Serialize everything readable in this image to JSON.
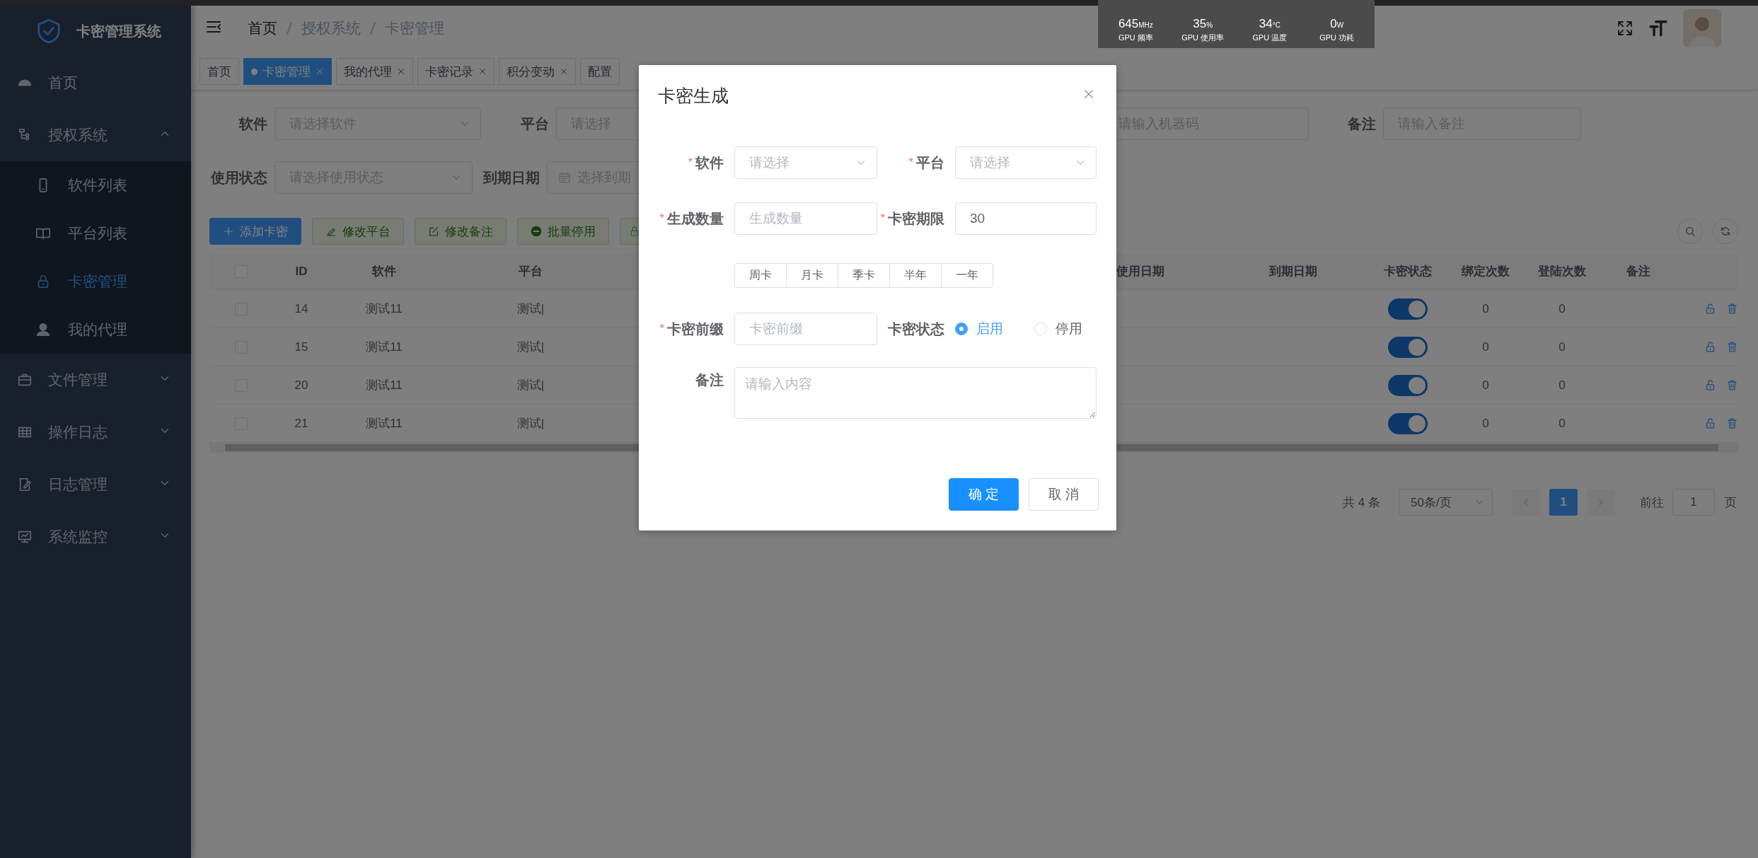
{
  "app": {
    "title": "卡密管理系统"
  },
  "sidebar": {
    "items": [
      {
        "label": "首页",
        "selected": false
      },
      {
        "label": "授权系统",
        "selected": false,
        "expanded": true,
        "children": [
          {
            "label": "软件列表",
            "selected": false
          },
          {
            "label": "平台列表",
            "selected": false
          },
          {
            "label": "卡密管理",
            "selected": true
          },
          {
            "label": "我的代理",
            "selected": false
          }
        ]
      },
      {
        "label": "文件管理",
        "selected": false,
        "expanded": false
      },
      {
        "label": "操作日志",
        "selected": false,
        "expanded": false
      },
      {
        "label": "日志管理",
        "selected": false,
        "expanded": false
      },
      {
        "label": "系统监控",
        "selected": false,
        "expanded": false
      }
    ]
  },
  "header": {
    "breadcrumb": [
      "首页",
      "授权系统",
      "卡密管理"
    ]
  },
  "perf_overlay": {
    "metrics": [
      {
        "value": "645",
        "unit": "MHz",
        "label": "GPU 频率"
      },
      {
        "value": "35",
        "unit": "%",
        "label": "GPU 使用率"
      },
      {
        "value": "34",
        "unit": "°C",
        "label": "GPU 温度"
      },
      {
        "value": "0",
        "unit": "W",
        "label": "GPU 功耗"
      }
    ]
  },
  "tabs": [
    {
      "label": "首页",
      "selected": false,
      "closable": false
    },
    {
      "label": "卡密管理",
      "selected": true,
      "closable": true
    },
    {
      "label": "我的代理",
      "selected": false,
      "closable": true
    },
    {
      "label": "卡密记录",
      "selected": false,
      "closable": true
    },
    {
      "label": "积分变动",
      "selected": false,
      "closable": true
    },
    {
      "label": "配置",
      "selected": false,
      "closable": false
    }
  ],
  "filters": {
    "row_1": [
      {
        "kind": "select",
        "label": "软件",
        "placeholder": "请选择软件"
      },
      {
        "kind": "input",
        "label": "平台",
        "placeholder": "请选择"
      },
      {
        "kind": "input",
        "placeholder": "请输入机器码"
      },
      {
        "kind": "input",
        "label": "备注",
        "placeholder": "请输入备注"
      }
    ],
    "row_2": [
      {
        "kind": "select",
        "label": "使用状态",
        "placeholder": "请选择使用状态"
      },
      {
        "kind": "date",
        "label": "到期日期",
        "placeholder": "选择到期"
      }
    ]
  },
  "toolbar": {
    "buttons": [
      {
        "kind": "primary",
        "label": "添加卡密",
        "disabled": false
      },
      {
        "kind": "plain",
        "label": "修改平台",
        "disabled": true
      },
      {
        "kind": "plain",
        "label": "修改备注",
        "disabled": true
      },
      {
        "kind": "plain",
        "label": "批量停用",
        "disabled": true
      },
      {
        "kind": "plain"
      }
    ]
  },
  "table": {
    "select_all": {
      "checked": false
    },
    "columns": [
      "ID",
      "软件",
      "平台",
      "使用日期",
      "到期日期",
      "卡密状态",
      "绑定次数",
      "登陆次数",
      "备注"
    ],
    "rows": [
      {
        "checked": false,
        "id": "14",
        "software": "测试11",
        "platform": "测试|",
        "enabled": true,
        "bind_count": "0",
        "login_count": "0"
      },
      {
        "checked": false,
        "id": "15",
        "software": "测试11",
        "platform": "测试|",
        "enabled": true,
        "bind_count": "0",
        "login_count": "0"
      },
      {
        "checked": false,
        "id": "20",
        "software": "测试11",
        "platform": "测试|",
        "enabled": true,
        "bind_count": "0",
        "login_count": "0"
      },
      {
        "checked": false,
        "id": "21",
        "software": "测试11",
        "platform": "测试|",
        "enabled": true,
        "bind_count": "0",
        "login_count": "0"
      }
    ]
  },
  "pagination": {
    "total": "共 4 条",
    "page_size": "50条/页",
    "pages": [
      {
        "label": "1",
        "selected": true
      }
    ],
    "goto_label": "前往",
    "goto_value": "1",
    "page_suffix": "页"
  },
  "modal": {
    "title": "卡密生成",
    "fields": [
      {
        "kind": "select",
        "label": "软件",
        "required_mark": "*",
        "placeholder": "请选择"
      },
      {
        "kind": "select",
        "label": "平台",
        "required_mark": "*",
        "placeholder": "请选择"
      },
      {
        "kind": "input",
        "label": "生成数量",
        "required_mark": "*",
        "placeholder": "生成数量"
      },
      {
        "kind": "input",
        "label": "卡密期限",
        "required_mark": "*",
        "value": "30"
      }
    ],
    "presets": [
      "周卡",
      "月卡",
      "季卡",
      "半年",
      "一年"
    ],
    "prefix": {
      "label": "卡密前缀",
      "required_mark": "*",
      "placeholder": "卡密前缀"
    },
    "status": {
      "label": "卡密状态",
      "options": [
        {
          "label": "启用",
          "selected": true
        },
        {
          "label": "停用",
          "selected": false
        }
      ]
    },
    "remark": {
      "label": "备注",
      "placeholder": "请输入内容"
    },
    "buttons": [
      {
        "kind": "primary",
        "label": "确 定"
      },
      {
        "kind": "default",
        "label": "取 消"
      }
    ]
  }
}
